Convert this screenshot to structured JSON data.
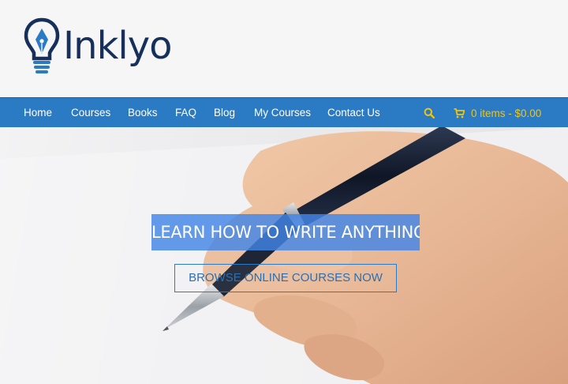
{
  "brand": {
    "name": "Inklyo"
  },
  "nav": {
    "items": [
      "Home",
      "Courses",
      "Books",
      "FAQ",
      "Blog",
      "My Courses",
      "Contact Us"
    ],
    "cart_text": "0 items - $0.00"
  },
  "hero": {
    "headline": "LEARN HOW TO WRITE ANYTHING",
    "cta": "BROWSE ONLINE COURSES NOW"
  },
  "colors": {
    "nav_bg": "#2b7bc4",
    "brand_dark": "#16305b",
    "brand_blue": "#2b7bc4",
    "accent_yellow": "#f1c40f",
    "headline_bg": "#4285e6"
  },
  "icons": {
    "search": "search-icon",
    "cart": "cart-icon",
    "logo": "lightbulb-pen-icon"
  }
}
